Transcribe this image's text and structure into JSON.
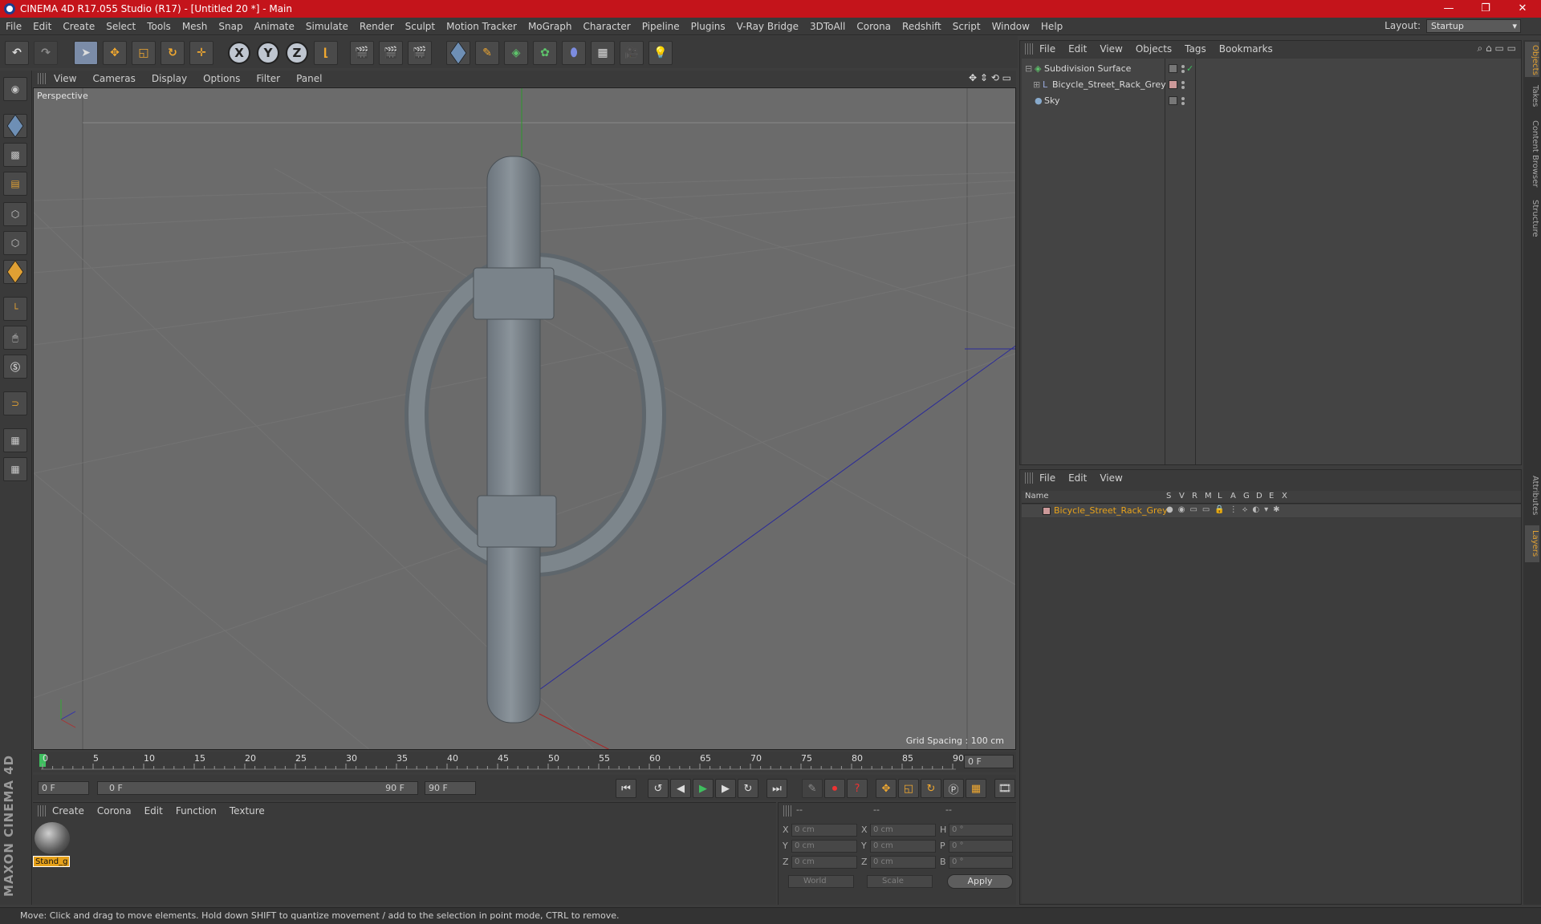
{
  "window": {
    "title": "CINEMA 4D R17.055 Studio (R17) - [Untitled 20 *] - Main",
    "buttons": [
      "—",
      "❐",
      "✕"
    ]
  },
  "menubar": {
    "items": [
      "File",
      "Edit",
      "Create",
      "Select",
      "Tools",
      "Mesh",
      "Snap",
      "Animate",
      "Simulate",
      "Render",
      "Sculpt",
      "Motion Tracker",
      "MoGraph",
      "Character",
      "Pipeline",
      "Plugins",
      "V-Ray Bridge",
      "3DToAll",
      "Corona",
      "Redshift",
      "Script",
      "Window",
      "Help"
    ],
    "layout_label": "Layout:",
    "layout_value": "Startup"
  },
  "toolbar": {
    "axis_x": "X",
    "axis_y": "Y",
    "axis_z": "Z"
  },
  "viewport": {
    "menu": [
      "View",
      "Cameras",
      "Display",
      "Options",
      "Filter",
      "Panel"
    ],
    "label": "Perspective",
    "grid_spacing": "Grid Spacing : 100 cm"
  },
  "timeline": {
    "ticks": [
      "0",
      "5",
      "10",
      "15",
      "20",
      "25",
      "30",
      "35",
      "40",
      "45",
      "50",
      "55",
      "60",
      "65",
      "70",
      "75",
      "80",
      "85",
      "90"
    ],
    "current_frame": "0 F",
    "start_field": "0 F",
    "range_start": "0 F",
    "range_end": "90 F",
    "end_field": "90 F"
  },
  "materials": {
    "menu": [
      "Create",
      "Corona",
      "Edit",
      "Function",
      "Texture"
    ],
    "items": [
      {
        "name": "Stand_g"
      }
    ]
  },
  "coordinates": {
    "headers": [
      "--",
      "--",
      "--"
    ],
    "rows": [
      {
        "a": "X",
        "av": "0 cm",
        "b": "X",
        "bv": "0 cm",
        "c": "H",
        "cv": "0 °"
      },
      {
        "a": "Y",
        "av": "0 cm",
        "b": "Y",
        "bv": "0 cm",
        "c": "P",
        "cv": "0 °"
      },
      {
        "a": "Z",
        "av": "0 cm",
        "b": "Z",
        "bv": "0 cm",
        "c": "B",
        "cv": "0 °"
      }
    ],
    "mode": "World",
    "transform": "Scale",
    "apply": "Apply"
  },
  "object_manager": {
    "menu": [
      "File",
      "Edit",
      "View",
      "Objects",
      "Tags",
      "Bookmarks"
    ],
    "objects": [
      {
        "name": "Subdivision Surface"
      },
      {
        "name": "Bicycle_Street_Rack_Grey"
      },
      {
        "name": "Sky"
      }
    ]
  },
  "layer_manager": {
    "menu": [
      "File",
      "Edit",
      "View"
    ],
    "columns": [
      "Name",
      "S",
      "V",
      "R",
      "M",
      "L",
      "A",
      "G",
      "D",
      "E",
      "X"
    ],
    "layers": [
      {
        "name": "Bicycle_Street_Rack_Grey"
      }
    ]
  },
  "side_tabs": [
    "Objects",
    "Takes",
    "Content Browser",
    "Structure",
    "Attributes",
    "Layers"
  ],
  "branding": "MAXON CINEMA 4D",
  "status": "Move: Click and drag to move elements. Hold down SHIFT to quantize movement / add to the selection in point mode, CTRL to remove."
}
